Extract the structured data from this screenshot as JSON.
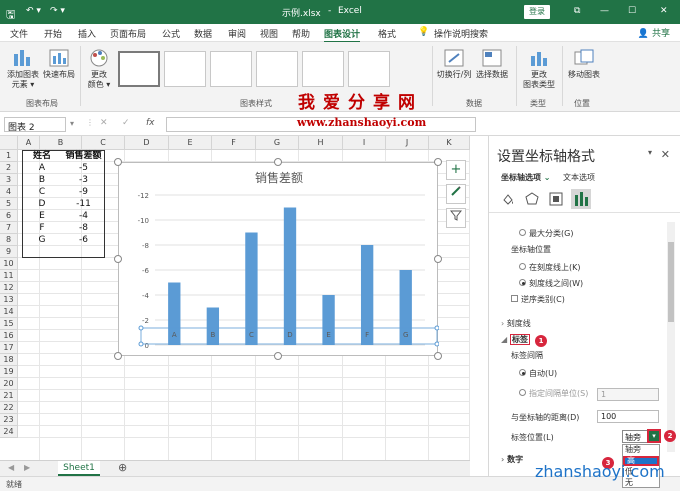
{
  "titlebar": {
    "filename": "示例.xlsx",
    "app": "Excel",
    "login": "登录",
    "restore": "⧉",
    "min": "—",
    "max": "☐",
    "close": "✕"
  },
  "menu": [
    "文件",
    "开始",
    "插入",
    "页面布局",
    "公式",
    "数据",
    "审阅",
    "视图",
    "帮助",
    "图表设计",
    "格式"
  ],
  "tell_me": "操作说明搜索",
  "share": "共享",
  "ribbon": {
    "add_element": "添加图表\n元素 ▾",
    "quick_layout": "快速布局",
    "change_colors": "更改\n颜色 ▾",
    "group_layout": "图表布局",
    "group_styles": "图表样式",
    "switch_rowcol": "切换行/列",
    "select_data": "选择数据",
    "group_data": "数据",
    "change_type": "更改\n图表类型",
    "group_type": "类型",
    "move_chart": "移动图表",
    "group_location": "位置"
  },
  "watermark": {
    "cn": "我爱分享网",
    "url": "www.zhanshaoyi.com",
    "url2": "zhanshaoyi.com"
  },
  "formula": {
    "namebox": "图表 2",
    "cancel": "✕",
    "enter": "✓",
    "fx": "fx"
  },
  "sheet": {
    "columns": [
      "A",
      "B",
      "C",
      "D",
      "E",
      "F",
      "G",
      "H",
      "I",
      "J",
      "K"
    ],
    "rows": [
      "1",
      "2",
      "3",
      "4",
      "5",
      "6",
      "7",
      "8",
      "9",
      "10",
      "11",
      "12",
      "13",
      "14",
      "15",
      "16",
      "17",
      "18",
      "19",
      "20",
      "21",
      "22",
      "23",
      "24"
    ],
    "header": [
      "姓名",
      "销售差额"
    ],
    "data": [
      [
        "A",
        "-5"
      ],
      [
        "B",
        "-3"
      ],
      [
        "C",
        "-9"
      ],
      [
        "D",
        "-11"
      ],
      [
        "E",
        "-4"
      ],
      [
        "F",
        "-8"
      ],
      [
        "G",
        "-6"
      ]
    ],
    "tab": "Sheet1",
    "add_tab": "⊕"
  },
  "chart_data": {
    "type": "bar",
    "title": "销售差额",
    "categories": [
      "A",
      "B",
      "C",
      "D",
      "E",
      "F",
      "G"
    ],
    "values": [
      -5,
      -3,
      -9,
      -11,
      -4,
      -8,
      -6
    ],
    "ylim": [
      0,
      -12
    ],
    "yticks": [
      "-12",
      "-10",
      "-8",
      "-6",
      "-4",
      "-2",
      "0"
    ],
    "y_reversed": true,
    "grid": true,
    "bar_color": "#5b9bd5"
  },
  "chart_side_buttons": [
    "+",
    "🖌",
    "⚲"
  ],
  "panel": {
    "title": "设置坐标轴格式",
    "close": "✕",
    "tab_axis": "坐标轴选项",
    "tab_text": "文本选项",
    "max_category": "最大分类(G)",
    "axis_position": "坐标轴位置",
    "on_tick": "在刻度线上(K)",
    "between_tick": "刻度线之间(W)",
    "reverse": "逆序类别(C)",
    "tick_marks": "刻度线",
    "labels": "标签",
    "label_interval": "标签间隔",
    "auto": "自动(U)",
    "specify_interval": "指定间隔单位(S)",
    "interval_value": "1",
    "distance_label": "与坐标轴的距离(D)",
    "distance_value": "100",
    "label_position": "标签位置(L)",
    "label_position_value": "轴旁",
    "number": "数字",
    "dropdown": [
      "轴旁",
      "高",
      "低",
      "无"
    ]
  },
  "markers": [
    "1",
    "2",
    "3"
  ],
  "status": {
    "ready": "就绪"
  }
}
